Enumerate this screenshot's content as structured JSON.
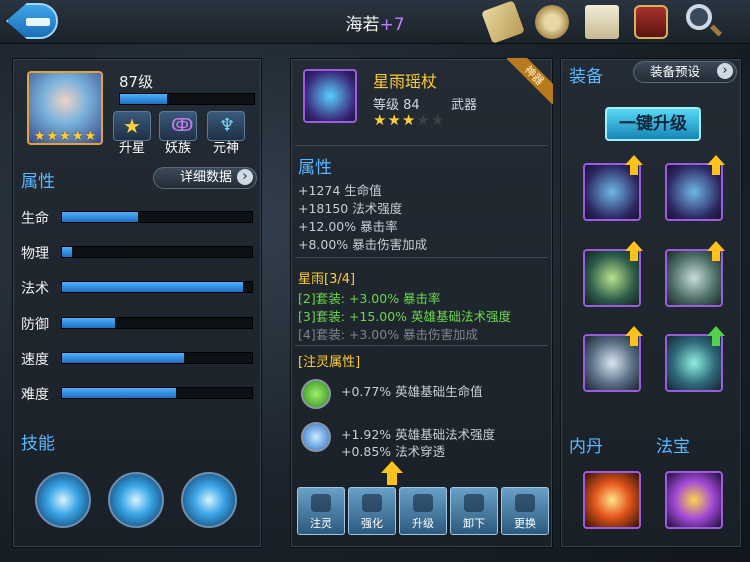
{
  "header": {
    "title": "海若",
    "title_plus": "+7"
  },
  "hero": {
    "level_text": "87级",
    "level_progress": 0.35,
    "stars": 5,
    "buttons": [
      {
        "label": "升星",
        "icon": "star-icon"
      },
      {
        "label": "妖族",
        "icon": "demon-clan-icon"
      },
      {
        "label": "元神",
        "icon": "spirit-icon"
      }
    ]
  },
  "attributes": {
    "title": "属性",
    "detail_button": "详细数据",
    "stats": [
      {
        "label": "生命",
        "value": 0.4
      },
      {
        "label": "物理",
        "value": 0.05
      },
      {
        "label": "法术",
        "value": 0.95
      },
      {
        "label": "防御",
        "value": 0.28
      },
      {
        "label": "速度",
        "value": 0.64
      },
      {
        "label": "难度",
        "value": 0.6
      }
    ]
  },
  "skills": {
    "title": "技能",
    "items": [
      "lightning-sphere-icon",
      "ice-burst-icon",
      "frost-beam-icon"
    ]
  },
  "item": {
    "name": "星雨瑶杖",
    "level": "等级 84",
    "type": "武器",
    "ribbon": "神器",
    "stars_on": 3,
    "stars_total": 5,
    "attr_title": "属性",
    "attrs": [
      "+1274 生命值",
      "+18150 法术强度",
      "+12.00% 暴击率",
      "+8.00% 暴击伤害加成"
    ],
    "set_title": "星雨[3/4]",
    "set_bonuses": [
      {
        "text": "[2]套装: +3.00% 暴击率",
        "active": true
      },
      {
        "text": "[3]套装: +15.00% 英雄基础法术强度",
        "active": true
      },
      {
        "text": "[4]套装: +3.00% 暴击伤害加成",
        "active": false
      }
    ],
    "infuse_title": "[注灵属性]",
    "infuse": [
      {
        "lines": [
          "+0.77% 英雄基础生命值"
        ]
      },
      {
        "lines": [
          "+1.92% 英雄基础法术强度",
          "+0.85% 法术穿透"
        ]
      }
    ],
    "actions": [
      "注灵",
      "强化",
      "升级",
      "卸下",
      "更换"
    ]
  },
  "equipment": {
    "title": "装备",
    "preset_button": "装备预设",
    "upgrade_button": "一键升级",
    "slots": [
      {
        "name": "staff-slot-1",
        "arrow": "yellow"
      },
      {
        "name": "staff-slot-2",
        "arrow": "yellow"
      },
      {
        "name": "helmet-slot",
        "arrow": "yellow"
      },
      {
        "name": "armor-slot",
        "arrow": "yellow"
      },
      {
        "name": "boots-slot",
        "arrow": "yellow"
      },
      {
        "name": "necklace-slot",
        "arrow": "green"
      }
    ],
    "neidan_label": "内丹",
    "fabao_label": "法宝"
  },
  "colors": {
    "accent_blue": "#59b8ff",
    "gold": "#ffcc33",
    "active_green": "#6ad94a"
  }
}
